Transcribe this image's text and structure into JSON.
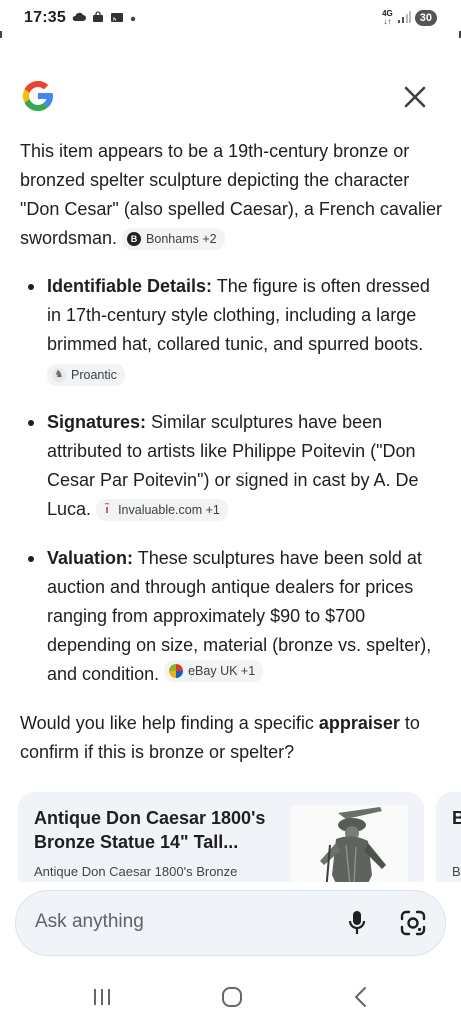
{
  "status_bar": {
    "time": "17:35",
    "notification_icons": [
      "cloud-icon",
      "bag-icon",
      "cast-icon",
      "dot-icon"
    ],
    "network_top": "4G",
    "network_bottom": "↓↑",
    "battery": "30"
  },
  "header": {
    "logo_letter": "G",
    "close_icon": "close-icon"
  },
  "answer": {
    "intro": "This item appears to be a 19th-century bronze or bronzed spelter sculpture depicting the character \"Don Cesar\" (also spelled Caesar), a French cavalier swordsman.",
    "intro_chip": {
      "icon_letter": "B",
      "label": "Bonhams +2"
    },
    "bullets": [
      {
        "heading": "Identifiable Details:",
        "text": "The figure is often dressed in 17th-century style clothing, including a large brimmed hat, collared tunic, and spurred boots.",
        "chip": {
          "icon": "proantic-icon",
          "label": "Proantic"
        }
      },
      {
        "heading": "Signatures:",
        "text": "Similar sculptures have been attributed to artists like Philippe Poitevin (\"Don Cesar Par Poitevin\") or signed in cast by A. De Luca.",
        "chip": {
          "icon": "invaluable-icon",
          "label": "Invaluable.com +1"
        }
      },
      {
        "heading": "Valuation:",
        "text": "These sculptures have been sold at auction and through antique dealers for prices ranging from approximately $90 to $700 depending on size, material (bronze vs. spelter), and condition.",
        "chip": {
          "icon": "ebay-icon",
          "label": "eBay UK +1"
        }
      }
    ],
    "question_before": "Would you like help finding a specific ",
    "question_bold": "appraiser",
    "question_after": " to confirm if this is bronze or spelter?"
  },
  "cards": [
    {
      "title": "Antique Don Caesar 1800's Bronze Statue 14\" Tall...",
      "snippet": "Antique Don Caesar 1800's Bronze"
    },
    {
      "title": "B F",
      "snippet": "B"
    }
  ],
  "ask_bar": {
    "placeholder": "Ask anything",
    "mic_icon": "mic-icon",
    "lens_icon": "lens-icon"
  },
  "nav": {
    "recents_icon": "recents-icon",
    "home_icon": "home-icon",
    "back_icon": "back-icon"
  },
  "colors": {
    "google_blue": "#4285F4",
    "google_red": "#EA4335",
    "google_yellow": "#FBBC05",
    "google_green": "#34A853",
    "chip_bg": "#f1f3f4",
    "card_bg": "#f0f4f9"
  }
}
